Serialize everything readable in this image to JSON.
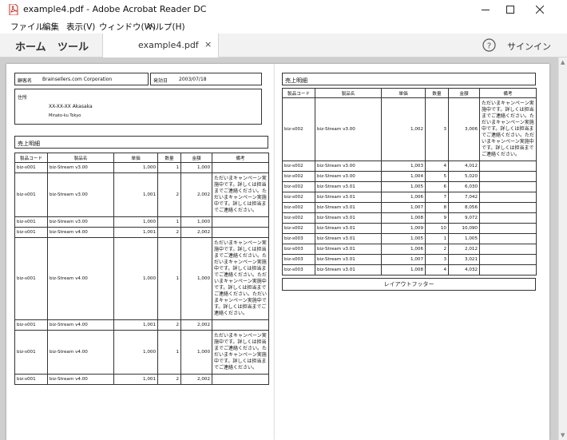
{
  "window": {
    "title": "example4.pdf - Adobe Acrobat Reader DC",
    "controls": {
      "minimize": "—",
      "maximize": "☐",
      "close": "✕"
    }
  },
  "menu": [
    "ファイル",
    "編集",
    "表示(V)",
    "ウィンドウ(W)",
    "ヘルプ(H)"
  ],
  "tabs": {
    "home": "ホーム",
    "tools": "ツール",
    "document": "example4.pdf",
    "close_glyph": "×",
    "help_glyph": "?",
    "signin": "サインイン"
  },
  "pdf": {
    "header": {
      "customer_label": "顧客名",
      "customer_value": "Brainsellers.com Corporation",
      "date_label": "発効日",
      "date_value": "2003/07/18",
      "address_label": "住所",
      "address_line1": "XX-XX-XX Akasaka",
      "address_line2": "Minato-ku Tokyo"
    },
    "section_title": "売上明細",
    "columns": [
      "製品コード",
      "製品名",
      "単価",
      "数量",
      "金額",
      "備考"
    ],
    "page1_rows": [
      {
        "code": "biz-s001",
        "name": "biz-Stream v3.00",
        "price": "1,000",
        "qty": "1",
        "amount": "1,000",
        "note": ""
      },
      {
        "code": "biz-s001",
        "name": "biz-Stream v3.00",
        "price": "1,001",
        "qty": "2",
        "amount": "2,002",
        "note": "ただいまキャンペーン実施中です。詳しくは担当までご連絡ください。ただいまキャンペーン実施中です。詳しくは担当までご連絡ください。"
      },
      {
        "code": "biz-s001",
        "name": "biz-Stream v3.00",
        "price": "1,000",
        "qty": "1",
        "amount": "1,000",
        "note": ""
      },
      {
        "code": "biz-s001",
        "name": "biz-Stream v4.00",
        "price": "1,001",
        "qty": "2",
        "amount": "2,002",
        "note": ""
      },
      {
        "code": "biz-s001",
        "name": "biz-Stream v4.00",
        "price": "1,000",
        "qty": "1",
        "amount": "1,000",
        "note": "ただいまキャンペーン実施中です。詳しくは担当までご連絡ください。ただいまキャンペーン実施中です。詳しくは担当までご連絡ください。ただいまキャンペーン実施中です。詳しくは担当までご連絡ください。ただいまキャンペーン実施中です。詳しくは担当までご連絡ください。"
      },
      {
        "code": "biz-s001",
        "name": "biz-Stream v4.00",
        "price": "1,001",
        "qty": "2",
        "amount": "2,002",
        "note": ""
      },
      {
        "code": "biz-s001",
        "name": "biz-Stream v4.00",
        "price": "1,000",
        "qty": "1",
        "amount": "1,000",
        "note": "ただいまキャンペーン実施中です。詳しくは担当までご連絡ください。ただいまキャンペーン実施中です。詳しくは担当までご連絡ください。"
      },
      {
        "code": "biz-s001",
        "name": "biz-Stream v4.00",
        "price": "1,001",
        "qty": "2",
        "amount": "2,002",
        "note": ""
      }
    ],
    "page2_rows": [
      {
        "code": "biz-s002",
        "name": "biz-Stream v3.00",
        "price": "1,002",
        "qty": "3",
        "amount": "3,006",
        "note": "ただいまキャンペーン実施中です。詳しくは担当までご連絡ください。ただいまキャンペーン実施中です。詳しくは担当までご連絡ください。ただいまキャンペーン実施中です。詳しくは担当までご連絡ください。"
      },
      {
        "code": "biz-s002",
        "name": "biz-Stream v3.00",
        "price": "1,003",
        "qty": "4",
        "amount": "4,012",
        "note": ""
      },
      {
        "code": "biz-s002",
        "name": "biz-Stream v3.00",
        "price": "1,004",
        "qty": "5",
        "amount": "5,020",
        "note": ""
      },
      {
        "code": "biz-s002",
        "name": "biz-Stream v3.01",
        "price": "1,005",
        "qty": "6",
        "amount": "6,030",
        "note": ""
      },
      {
        "code": "biz-s002",
        "name": "biz-Stream v3.01",
        "price": "1,006",
        "qty": "7",
        "amount": "7,042",
        "note": ""
      },
      {
        "code": "biz-s002",
        "name": "biz-Stream v3.01",
        "price": "1,007",
        "qty": "8",
        "amount": "8,056",
        "note": ""
      },
      {
        "code": "biz-s002",
        "name": "biz-Stream v3.01",
        "price": "1,008",
        "qty": "9",
        "amount": "9,072",
        "note": ""
      },
      {
        "code": "biz-s002",
        "name": "biz-Stream v3.01",
        "price": "1,009",
        "qty": "10",
        "amount": "10,090",
        "note": ""
      },
      {
        "code": "biz-s003",
        "name": "biz-Stream v3.01",
        "price": "1,005",
        "qty": "1",
        "amount": "1,005",
        "note": ""
      },
      {
        "code": "biz-s003",
        "name": "biz-Stream v3.01",
        "price": "1,006",
        "qty": "2",
        "amount": "2,012",
        "note": ""
      },
      {
        "code": "biz-s003",
        "name": "biz-Stream v3.01",
        "price": "1,007",
        "qty": "3",
        "amount": "3,021",
        "note": ""
      },
      {
        "code": "biz-s003",
        "name": "biz-Stream v3.01",
        "price": "1,008",
        "qty": "4",
        "amount": "4,032",
        "note": ""
      }
    ],
    "layout_footer": "レイアウトフッター"
  },
  "colors": {
    "app_icon_red": "#d9261c",
    "viewer_bg": "#cfcfcf",
    "tabbar_bg": "#f2f2f2"
  }
}
